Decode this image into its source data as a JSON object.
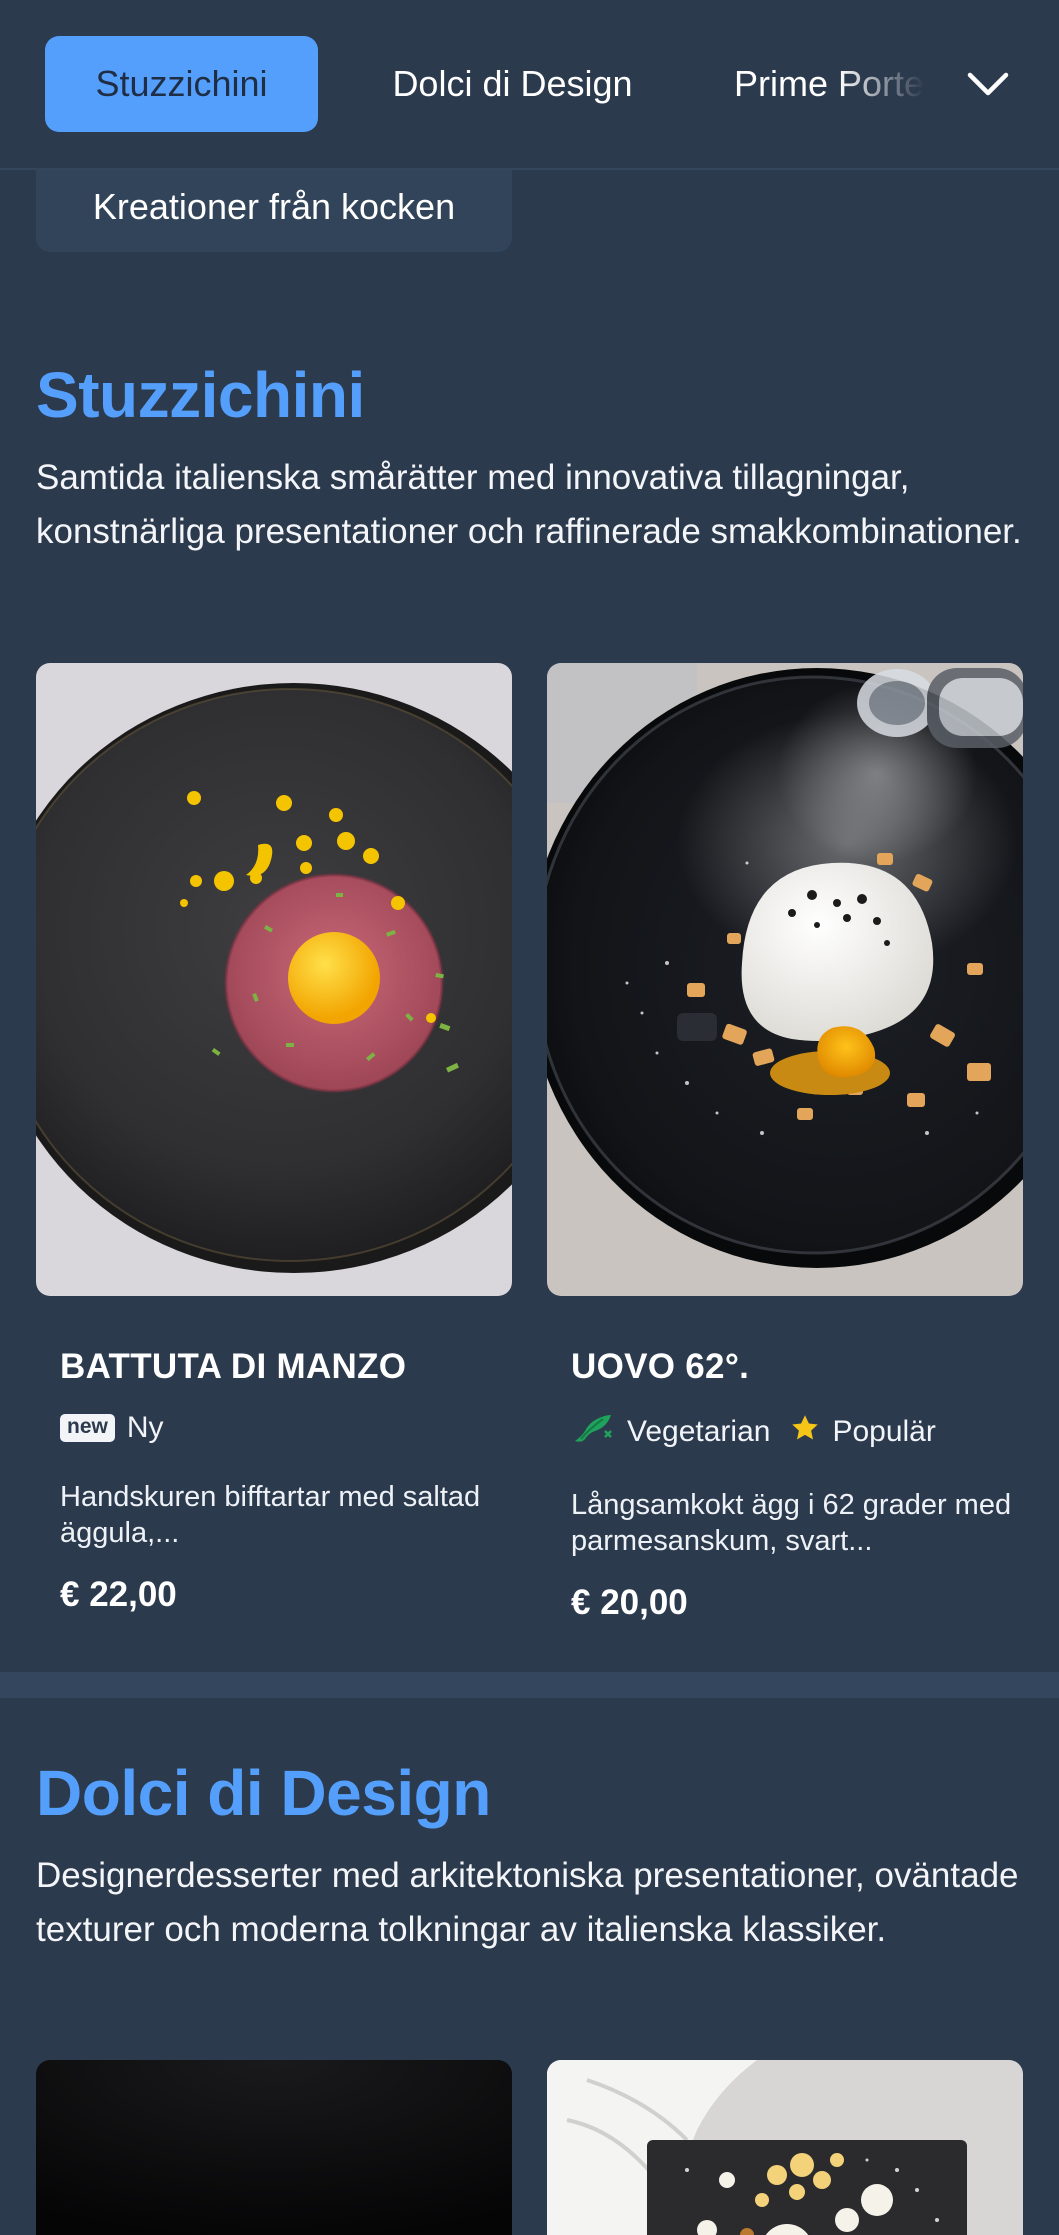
{
  "nav": {
    "tabs": [
      {
        "label": "Stuzzichini",
        "active": true
      },
      {
        "label": "Dolci di Design",
        "active": false
      },
      {
        "label": "Prime Porte",
        "active": false
      }
    ],
    "more_icon": "chevron-down-icon"
  },
  "chef_link": "Kreationer från kocken",
  "sections": [
    {
      "title": "Stuzzichini",
      "description": "Samtida italienska smårätter med innovativa tillagningar, konstnärliga presentationer och raffinerade smakkombinationer.",
      "items": [
        {
          "name": "BATTUTA DI MANZO",
          "tags": [
            {
              "icon": "new-badge",
              "badge": "new",
              "label": "Ny"
            }
          ],
          "description": "Handskuren bifftartar med saltad äggula,...",
          "price": "€ 22,00"
        },
        {
          "name": "UOVO 62°.",
          "tags": [
            {
              "icon": "vegetarian-icon",
              "label": "Vegetarian"
            },
            {
              "icon": "star-icon",
              "label": "Populär"
            }
          ],
          "description": "Långsamkokt ägg i 62 grader med parmesanskum, svart...",
          "price": "€ 20,00"
        }
      ]
    },
    {
      "title": "Dolci di Design",
      "description": "Designerdesserter med arkitektoniska presentationer, oväntade texturer och moderna tolkningar av italienska klassiker."
    }
  ],
  "colors": {
    "background": "#2c3a4d",
    "accent": "#559ffc",
    "vegetarian": "#1fa35c",
    "star": "#f5c518"
  }
}
